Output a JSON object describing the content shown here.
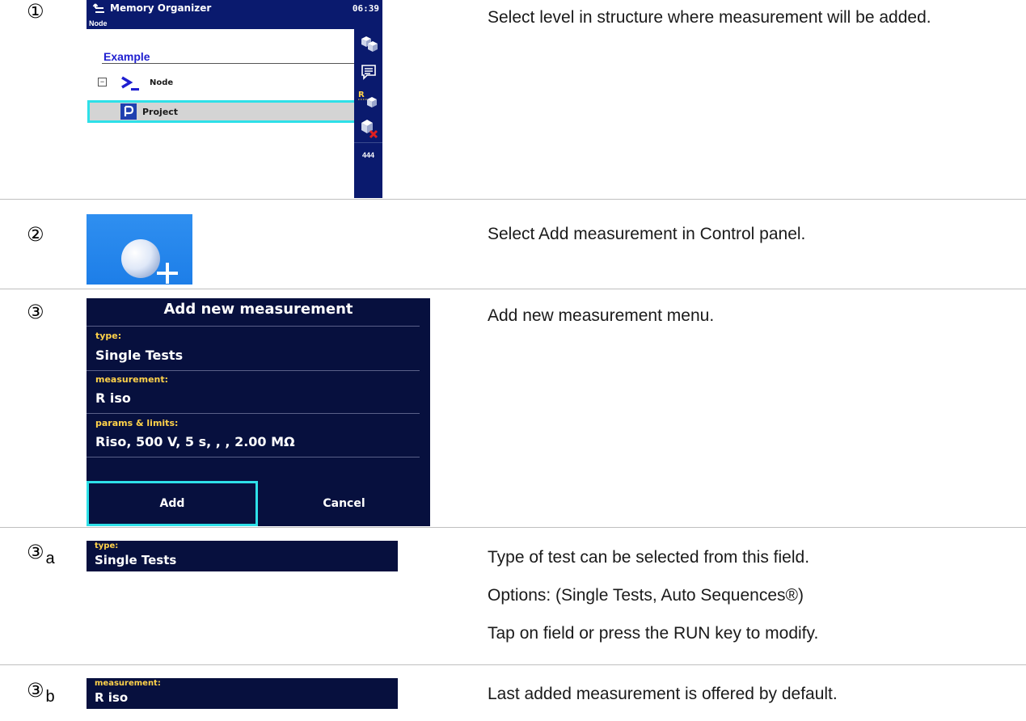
{
  "steps": [
    {
      "marker": "①",
      "text": [
        "Select level in structure where measurement will be added."
      ]
    },
    {
      "marker": "②",
      "text": [
        "Select Add measurement in Control panel."
      ]
    },
    {
      "marker": "③",
      "text": [
        "Add new measurement menu."
      ]
    },
    {
      "marker": "③",
      "sub": "a",
      "text": [
        "Type of test can be selected from this field.",
        "Options: (Single Tests, Auto Sequences®)",
        "Tap on field or press the RUN key to modify."
      ]
    },
    {
      "marker": "③",
      "sub": "b",
      "text": [
        "Last added measurement is offered by default."
      ]
    }
  ],
  "memory_organizer": {
    "title": "Memory Organizer",
    "time": "06:39",
    "subheader": "Node",
    "example": "Example",
    "node_label": "Node",
    "project_label": "Project",
    "collapse_symbol": "⊟",
    "more_symbol": "444"
  },
  "add_measurement": {
    "title": "Add new measurement",
    "type_label": "type:",
    "type_value": "Single Tests",
    "measurement_label": "measurement:",
    "measurement_value": "R iso",
    "params_label": "params & limits:",
    "params_value": "Riso, 500 V, 5 s, , , 2.00 MΩ",
    "add_button": "Add",
    "cancel_button": "Cancel"
  },
  "colors": {
    "header_blue": "#0a1a6e",
    "dark_panel": "#07103e",
    "label_yellow": "#ffd24a",
    "highlight_cyan": "#2ee0e8",
    "example_blue": "#1f1fd0"
  }
}
